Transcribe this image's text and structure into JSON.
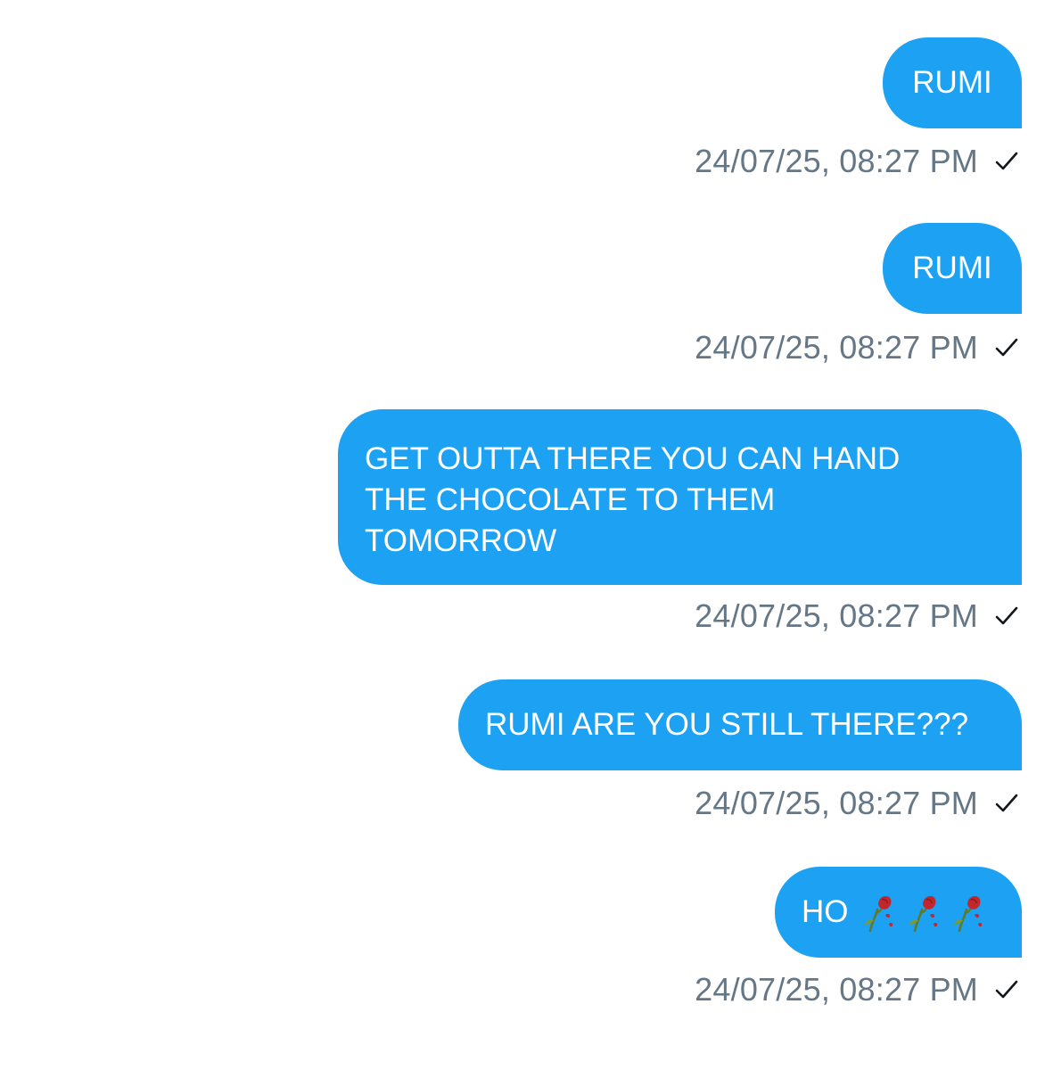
{
  "conversation": {
    "messages": [
      {
        "text": "RUMI",
        "timestamp": "24/07/25, 08:27 PM",
        "status_icon": "sent-check-icon"
      },
      {
        "text": "RUMI",
        "timestamp": "24/07/25, 08:27 PM",
        "status_icon": "sent-check-icon"
      },
      {
        "text": "GET OUTTA THERE YOU CAN HAND\nTHE CHOCOLATE TO THEM\nTOMORROW",
        "timestamp": "24/07/25, 08:27 PM",
        "status_icon": "sent-check-icon"
      },
      {
        "text": "RUMI ARE YOU STILL THERE???",
        "timestamp": "24/07/25, 08:27 PM",
        "status_icon": "sent-check-icon"
      },
      {
        "text": "HO",
        "emoji": [
          "wilted-flower-icon",
          "wilted-flower-icon",
          "wilted-flower-icon"
        ],
        "timestamp": "24/07/25, 08:27 PM",
        "status_icon": "sent-check-icon"
      }
    ]
  },
  "colors": {
    "bubble_background": "#1da1f2",
    "bubble_text": "#ffffff",
    "timestamp_text": "#657786",
    "check_icon": "#14171a",
    "page_background": "#ffffff"
  }
}
